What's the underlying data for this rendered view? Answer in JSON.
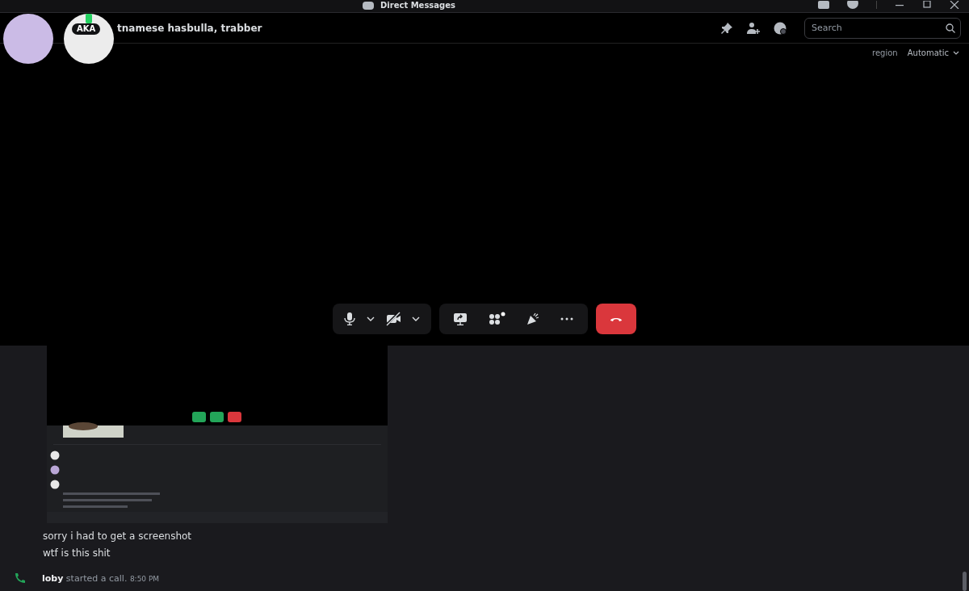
{
  "title_bar": {
    "title": "Direct Messages"
  },
  "header": {
    "badge": "AKA",
    "names": "tnamese hasbulla, trabber",
    "search": {
      "placeholder": "Search"
    }
  },
  "call": {
    "region_label": "region",
    "region_value": "Automatic",
    "camera": {
      "on": false
    },
    "apps": {
      "notification": true
    }
  },
  "messages": [
    "sorry i had to get a screenshot",
    "wtf is this shit"
  ],
  "call_event": {
    "author": "loby",
    "text": "started a call.",
    "time": "8:50 PM"
  }
}
